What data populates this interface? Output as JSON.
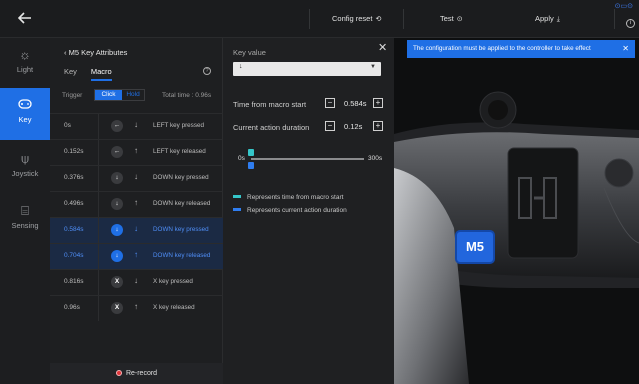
{
  "topbar": {
    "config_reset": "Config reset",
    "test": "Test",
    "apply": "Apply",
    "apply_icon": "download-icon",
    "test_icon": "play-circle-icon",
    "info_icon": "info-icon"
  },
  "sidebar": {
    "items": [
      {
        "label": "Light",
        "icon": "sun-icon",
        "active": false
      },
      {
        "label": "Key",
        "icon": "gamepad-icon",
        "active": true
      },
      {
        "label": "Joystick",
        "icon": "joystick-icon",
        "active": false
      },
      {
        "label": "Sensing",
        "icon": "sensing-icon",
        "active": false
      }
    ]
  },
  "key_panel": {
    "title": "M5 Key Attributes",
    "tabs": [
      "Key",
      "Macro"
    ],
    "active_tab": "Macro",
    "trigger_label": "Trigger",
    "trigger_options": [
      "Click",
      "Hold"
    ],
    "trigger_selected": "Click",
    "total_time": "Total time : 0.96s",
    "rows": [
      {
        "time": "0s",
        "key": "←",
        "action": "↓",
        "desc": "LEFT key pressed",
        "selected": false
      },
      {
        "time": "0.152s",
        "key": "←",
        "action": "↑",
        "desc": "LEFT key released",
        "selected": false
      },
      {
        "time": "0.376s",
        "key": "↓",
        "action": "↓",
        "desc": "DOWN key pressed",
        "selected": false
      },
      {
        "time": "0.496s",
        "key": "↓",
        "action": "↑",
        "desc": "DOWN key released",
        "selected": false
      },
      {
        "time": "0.584s",
        "key": "↓",
        "action": "↓",
        "desc": "DOWN key pressed",
        "selected": true
      },
      {
        "time": "0.704s",
        "key": "↓",
        "action": "↑",
        "desc": "DOWN key released",
        "selected": true
      },
      {
        "time": "0.816s",
        "key": "X",
        "action": "↓",
        "desc": "X key pressed",
        "selected": false
      },
      {
        "time": "0.96s",
        "key": "X",
        "action": "↑",
        "desc": "X key released",
        "selected": false
      }
    ],
    "rerecord": "Re-record"
  },
  "kv_panel": {
    "key_value_label": "Key value",
    "key_value": "↓",
    "time_from_start_label": "Time from macro start",
    "time_from_start_value": "0.584s",
    "current_duration_label": "Current action duration",
    "current_duration_value": "0.12s",
    "slider_start": "0s",
    "slider_end": "300s",
    "legend_cyan": "Represents time from macro start",
    "legend_blue": "Represents current action duration",
    "color_cyan": "#35c6c9",
    "color_blue": "#2f7df0"
  },
  "controller": {
    "toast": "The configuration must be applied to the controller to take effect",
    "key_label": "M5"
  },
  "colors": {
    "accent": "#1f6fe5",
    "background": "#161718"
  }
}
